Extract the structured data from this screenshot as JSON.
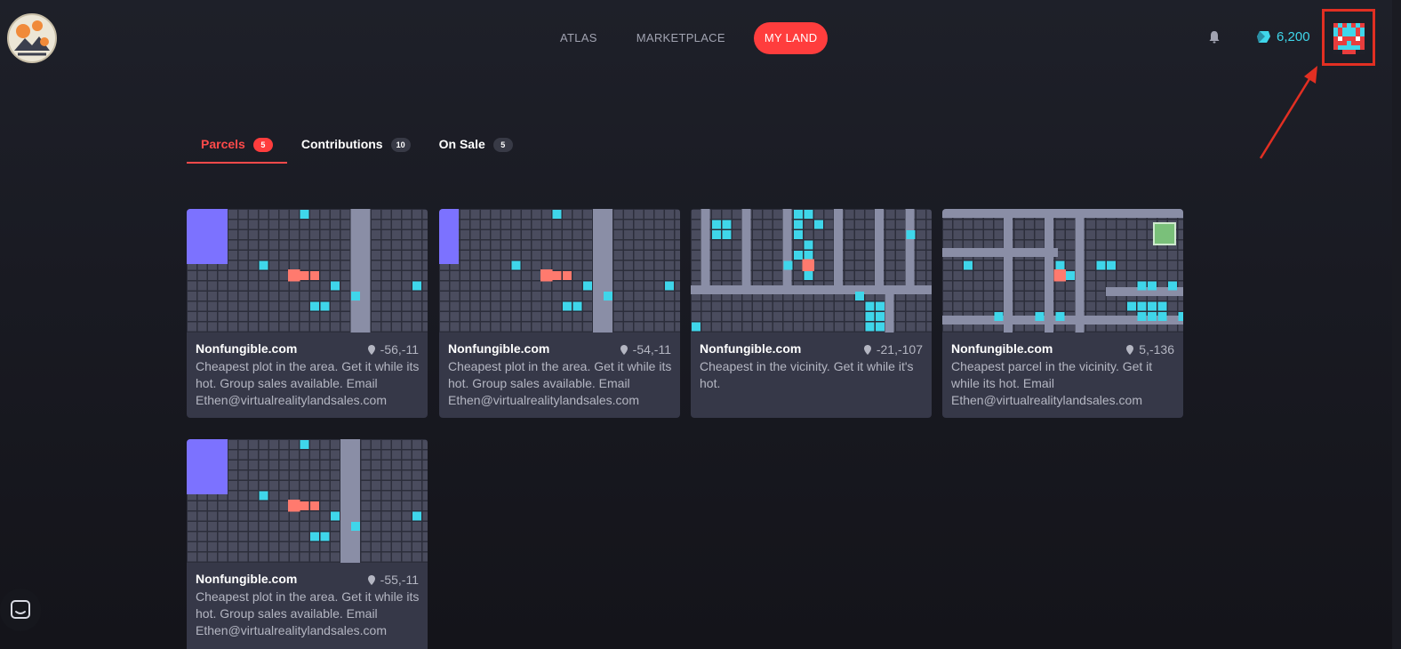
{
  "nav": {
    "items": [
      {
        "label": "ATLAS",
        "active": false
      },
      {
        "label": "MARKETPLACE",
        "active": false
      },
      {
        "label": "MY LAND",
        "active": true
      }
    ]
  },
  "header": {
    "balance": "6,200",
    "icons": {
      "notifications": "bell-icon",
      "currency": "mana-icon",
      "avatar": "pixel-avatar"
    }
  },
  "tabs": [
    {
      "label": "Parcels",
      "count": "5",
      "active": true
    },
    {
      "label": "Contributions",
      "count": "10",
      "active": false
    },
    {
      "label": "On Sale",
      "count": "5",
      "active": false
    }
  ],
  "parcels": [
    {
      "title": "Nonfungible.com",
      "coords": "-56,-11",
      "description": "Cheapest plot in the area. Get it while its hot. Group sales available. Email Ethen@virtualrealitylandsales.com"
    },
    {
      "title": "Nonfungible.com",
      "coords": "-54,-11",
      "description": "Cheapest plot in the area. Get it while its hot. Group sales available. Email Ethen@virtualrealitylandsales.com"
    },
    {
      "title": "Nonfungible.com",
      "coords": "-21,-107",
      "description": "Cheapest in the vicinity. Get it while it's hot."
    },
    {
      "title": "Nonfungible.com",
      "coords": "5,-136",
      "description": "Cheapest parcel in the vicinity. Get it while its hot. Email Ethen@virtualrealitylandsales.com"
    },
    {
      "title": "Nonfungible.com",
      "coords": "-55,-11",
      "description": "Cheapest plot in the area. Get it while its hot. Group sales available. Email Ethen@virtualrealitylandsales.com"
    }
  ],
  "colors": {
    "accent": "#ff3d3d",
    "balance": "#3fd6ea",
    "annotation": "#e22f22",
    "tile": "#4a4c5e",
    "road": "#8a8ea6",
    "owned": "#3fd6ea",
    "selected": "#ff7a6e",
    "district": "#7c72ff",
    "plaza": "#7ac07a"
  }
}
